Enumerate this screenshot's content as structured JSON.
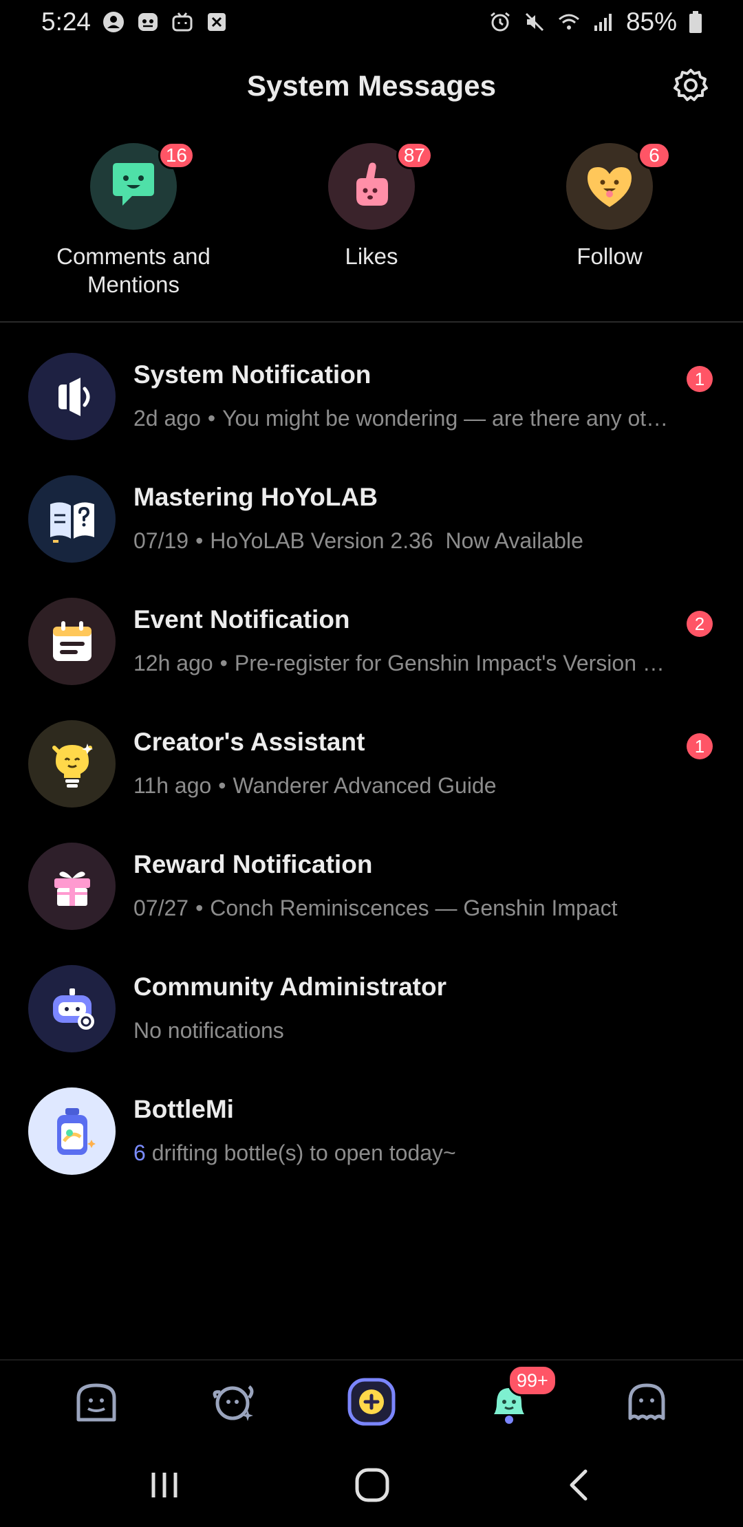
{
  "status_bar": {
    "time": "5:24",
    "battery": "85%",
    "icons_left": [
      "profile-icon",
      "game-icon",
      "bilibili-icon",
      "x-icon"
    ],
    "icons_right": [
      "alarm-icon",
      "mute-icon",
      "wifi-icon",
      "signal-icon",
      "battery-icon"
    ]
  },
  "header": {
    "title": "System Messages",
    "settings_icon": "gear-icon"
  },
  "quick": [
    {
      "label_line1": "Comments and",
      "label_line2": "Mentions",
      "badge": "16",
      "icon": "chat-face-icon",
      "bg": "#1f3b38",
      "color": "#4fe0a8"
    },
    {
      "label_line1": "Likes",
      "label_line2": "",
      "badge": "87",
      "icon": "thumbs-up-icon",
      "bg": "#3a232b",
      "color": "#ff8fa8"
    },
    {
      "label_line1": "Follow",
      "label_line2": "",
      "badge": "6",
      "icon": "heart-face-icon",
      "bg": "#3a2e22",
      "color": "#ffc75a"
    }
  ],
  "messages": [
    {
      "title": "System Notification",
      "time": "2d ago",
      "text": "You might be wondering — are there any ot…",
      "badge": "1",
      "icon": "megaphone-icon",
      "bg": "#1e2142"
    },
    {
      "title": "Mastering HoYoLAB",
      "time": "07/19",
      "text": "HoYoLAB Version 2.36  Now Available",
      "badge": "",
      "icon": "book-question-icon",
      "bg": "#17253e"
    },
    {
      "title": "Event Notification",
      "time": "12h ago",
      "text": "Pre-register for Genshin Impact's Version …",
      "badge": "2",
      "icon": "calendar-icon",
      "bg": "#2e1f24"
    },
    {
      "title": "Creator's Assistant",
      "time": "11h ago",
      "text": "Wanderer Advanced Guide",
      "badge": "1",
      "icon": "lightbulb-icon",
      "bg": "#2e2a1e"
    },
    {
      "title": "Reward Notification",
      "time": "07/27",
      "text": "Conch Reminiscences — Genshin Impact",
      "badge": "",
      "icon": "gift-icon",
      "bg": "#2e1f2a"
    },
    {
      "title": "Community Administrator",
      "time": "",
      "text": "No notifications",
      "badge": "",
      "icon": "admin-robot-icon",
      "bg": "#1e2142"
    },
    {
      "title": "BottleMi",
      "time": "",
      "count": "6",
      "text": "drifting bottle(s) to open today~",
      "badge": "",
      "icon": "bottle-icon",
      "bg": "#dfe8ff"
    }
  ],
  "dot": "•",
  "bottom_nav": {
    "items": [
      "home-icon",
      "explore-icon",
      "post-icon",
      "notification-bell-icon",
      "profile-ghost-icon"
    ],
    "notification_badge": "99+",
    "accent": "#7b86ff"
  },
  "system_nav": [
    "recents-icon",
    "home-circle-icon",
    "back-icon"
  ]
}
